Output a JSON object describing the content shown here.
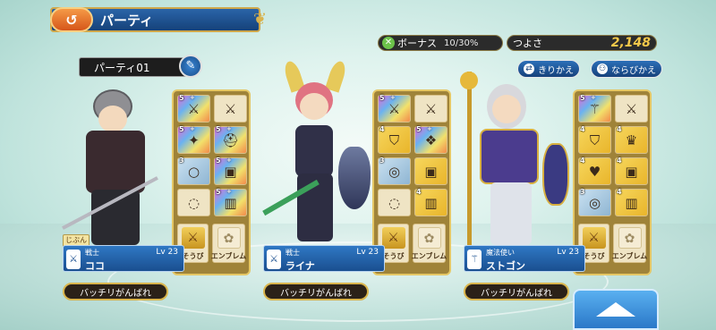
{
  "title": "パーティ",
  "bonus": {
    "label": "ボーナス",
    "value": "10/30%"
  },
  "strength": {
    "label": "つよさ",
    "value": "2,148"
  },
  "buttons": {
    "switch": "きりかえ",
    "arrange": "ならびかえ"
  },
  "party_name": "パーティ01",
  "self_tag": "じぶん",
  "equip_labels": {
    "equip": "そうび",
    "emblem": "エンブレム"
  },
  "members": [
    {
      "job": "戦士",
      "level": "Lv 23",
      "name": "ココ",
      "tactic": "バッチリがんばれ",
      "slots": [
        {
          "rank": "5",
          "plus": "+"
        },
        {
          "rank": "",
          "plus": ""
        },
        {
          "rank": "5",
          "plus": "+"
        },
        {
          "rank": "5",
          "plus": "+"
        },
        {
          "rank": "3",
          "plus": ""
        },
        {
          "rank": "5",
          "plus": "+"
        },
        {
          "rank": "",
          "plus": ""
        },
        {
          "rank": "5",
          "plus": "+"
        }
      ]
    },
    {
      "job": "戦士",
      "level": "Lv 23",
      "name": "ライナ",
      "tactic": "バッチリがんばれ",
      "slots": [
        {
          "rank": "5",
          "plus": "+"
        },
        {
          "rank": "",
          "plus": ""
        },
        {
          "rank": "4",
          "plus": ""
        },
        {
          "rank": "5",
          "plus": "+"
        },
        {
          "rank": "3",
          "plus": ""
        },
        {
          "rank": "",
          "plus": ""
        },
        {
          "rank": "",
          "plus": ""
        },
        {
          "rank": "4",
          "plus": ""
        }
      ]
    },
    {
      "job": "魔法使い",
      "level": "Lv 23",
      "name": "ストゴン",
      "tactic": "バッチリがんばれ",
      "slots": [
        {
          "rank": "5",
          "plus": "+"
        },
        {
          "rank": "",
          "plus": ""
        },
        {
          "rank": "4",
          "plus": ""
        },
        {
          "rank": "4",
          "plus": ""
        },
        {
          "rank": "4",
          "plus": ""
        },
        {
          "rank": "4",
          "plus": ""
        },
        {
          "rank": "3",
          "plus": ""
        },
        {
          "rank": "4",
          "plus": ""
        }
      ]
    }
  ]
}
